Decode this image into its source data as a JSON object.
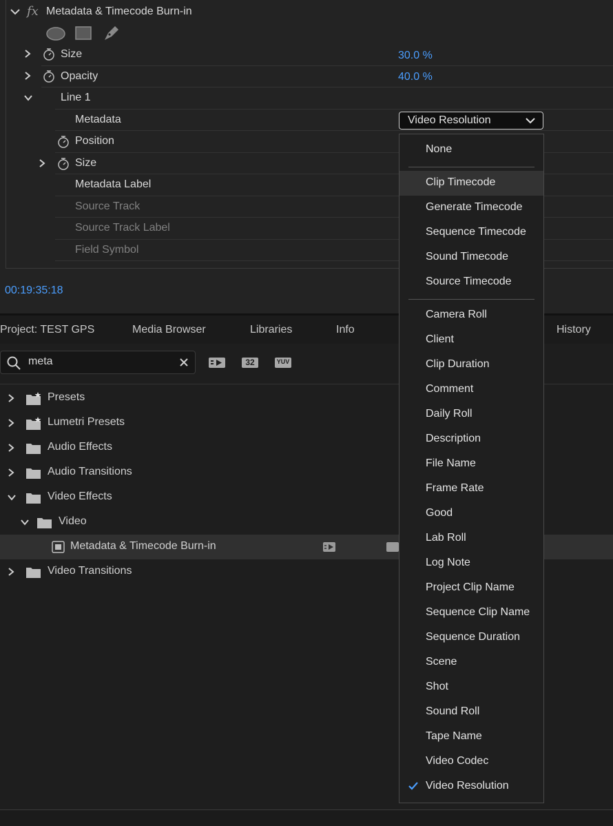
{
  "effect_controls": {
    "effect_name": "Metadata & Timecode Burn-in",
    "fx_label": "fx",
    "mask_tools": [
      "ellipse-mask-icon",
      "rectangle-mask-icon",
      "pen-mask-icon"
    ],
    "rows": {
      "size": {
        "label": "Size",
        "value": "30.0 %"
      },
      "opacity": {
        "label": "Opacity",
        "value": "40.0 %"
      },
      "line1": {
        "label": "Line 1"
      },
      "metadata": {
        "label": "Metadata",
        "value": "Video Resolution"
      },
      "position": {
        "label": "Position"
      },
      "size2": {
        "label": "Size"
      },
      "metadata_label": {
        "label": "Metadata Label"
      },
      "source_track": {
        "label": "Source Track"
      },
      "source_track_label": {
        "label": "Source Track Label"
      },
      "field_symbol": {
        "label": "Field Symbol"
      }
    },
    "timecode": "00:19:35:18"
  },
  "effects_panel": {
    "tabs": [
      "Project: TEST GPS",
      "Media Browser",
      "Libraries",
      "Info",
      "History"
    ],
    "search": {
      "value": "meta",
      "placeholder": ""
    },
    "filter_icons": [
      "accelerated-effects-icon",
      "32-bit-icon",
      "yuv-icon"
    ],
    "filter_labels": {
      "bit32": "32",
      "yuv": "YUV"
    },
    "tree": {
      "presets": "Presets",
      "lumetri_presets": "Lumetri Presets",
      "audio_effects": "Audio Effects",
      "audio_transitions": "Audio Transitions",
      "video_effects": "Video Effects",
      "video": "Video",
      "metadata_timecode": "Metadata & Timecode Burn-in",
      "video_transitions": "Video Transitions"
    }
  },
  "dropdown": {
    "selected": "Video Resolution",
    "items": {
      "none": "None",
      "clip_timecode": "Clip Timecode",
      "generate_timecode": "Generate Timecode",
      "sequence_timecode": "Sequence Timecode",
      "sound_timecode": "Sound Timecode",
      "source_timecode": "Source Timecode",
      "camera_roll": "Camera Roll",
      "client": "Client",
      "clip_duration": "Clip Duration",
      "comment": "Comment",
      "daily_roll": "Daily Roll",
      "description": "Description",
      "file_name": "File Name",
      "frame_rate": "Frame Rate",
      "good": "Good",
      "lab_roll": "Lab Roll",
      "log_note": "Log Note",
      "project_clip_name": "Project Clip Name",
      "sequence_clip_name": "Sequence Clip Name",
      "sequence_duration": "Sequence Duration",
      "scene": "Scene",
      "shot": "Shot",
      "sound_roll": "Sound Roll",
      "tape_name": "Tape Name",
      "video_codec": "Video Codec",
      "video_resolution": "Video Resolution"
    }
  },
  "colors": {
    "accent": "#4b9eff",
    "panel": "#232323",
    "menu": "#1f1f1f"
  }
}
